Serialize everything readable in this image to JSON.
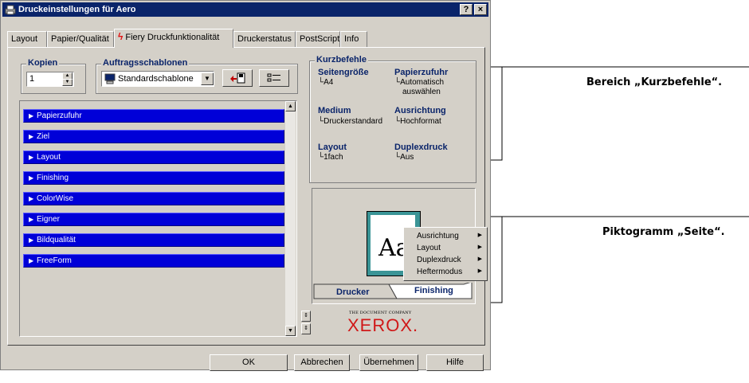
{
  "window": {
    "title": "Druckeinstellungen für Aero",
    "help_btn": "?",
    "close_btn": "×"
  },
  "tabs": [
    {
      "label": "Layout"
    },
    {
      "label": "Papier/Qualität"
    },
    {
      "label": "Fiery Druckfunktionalität",
      "active": true
    },
    {
      "label": "Druckerstatus"
    },
    {
      "label": "PostScript"
    },
    {
      "label": "Info"
    }
  ],
  "kopien": {
    "title": "Kopien",
    "value": "1"
  },
  "auftrag": {
    "title": "Auftragsschablonen",
    "selected": "Standardschablone"
  },
  "sections": [
    {
      "label": "Papierzufuhr"
    },
    {
      "label": "Ziel"
    },
    {
      "label": "Layout"
    },
    {
      "label": "Finishing"
    },
    {
      "label": "ColorWise"
    },
    {
      "label": "Eigner"
    },
    {
      "label": "Bildqualität"
    },
    {
      "label": "FreeForm"
    }
  ],
  "kurzbefehle": {
    "title": "Kurzbefehle",
    "items": [
      {
        "label": "Seitengröße",
        "value": "A4"
      },
      {
        "label": "Papierzufuhr",
        "value": "Automatisch",
        "value2": "auswählen"
      },
      {
        "label": "Medium",
        "value": "Druckerstandard"
      },
      {
        "label": "Ausrichtung",
        "value": "Hochformat"
      },
      {
        "label": "Layout",
        "value": "1fach"
      },
      {
        "label": "Duplexdruck",
        "value": "Aus"
      }
    ]
  },
  "preview": {
    "page_text": "Aa",
    "tab_drucker": "Drucker",
    "tab_finishing": "Finishing",
    "menu": [
      {
        "label": "Ausrichtung"
      },
      {
        "label": "Layout"
      },
      {
        "label": "Duplexdruck"
      },
      {
        "label": "Heftermodus"
      }
    ]
  },
  "logo": {
    "small": "THE DOCUMENT COMPANY",
    "big": "XEROX."
  },
  "buttons": {
    "ok": "OK",
    "cancel": "Abbrechen",
    "apply": "Übernehmen",
    "help": "Hilfe"
  },
  "annotations": {
    "kurzbefehle": "Bereich „Kurzbefehle“.",
    "seite": "Piktogramm „Seite“."
  },
  "colors": {
    "title_bar": "#0a246a",
    "section_bar": "#0000d8",
    "heading_blue": "#0a246a",
    "xerox_red": "#d01818",
    "page_teal": "#3a9496"
  }
}
